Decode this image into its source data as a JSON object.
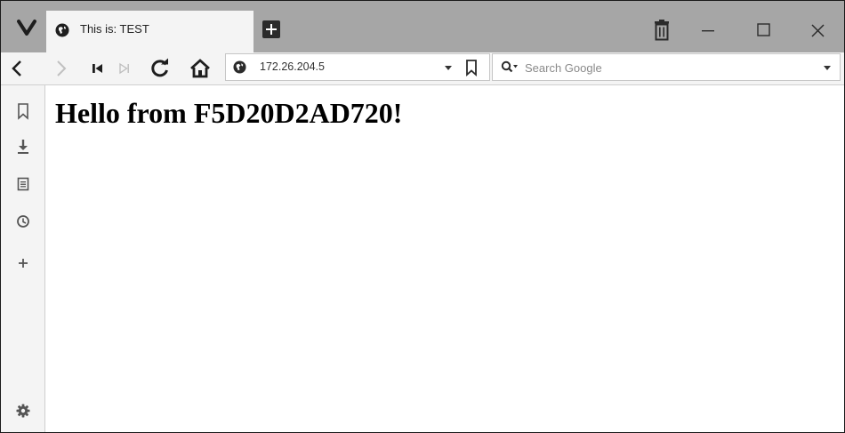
{
  "browser": {
    "logo_icon": "vivaldi-logo-icon",
    "accent_color": "#a6a6a6"
  },
  "tab": {
    "title": "This is: TEST",
    "icon": "globe-icon"
  },
  "titlebar": {
    "new_tab_icon": "plus-square-icon",
    "trash_icon": "trash-icon",
    "window_controls": [
      "minimize-icon",
      "maximize-icon",
      "close-icon"
    ]
  },
  "navigation": {
    "icons": [
      "back-icon",
      "forward-icon",
      "rewind-icon",
      "fast-forward-icon",
      "reload-icon",
      "home-icon"
    ]
  },
  "address": {
    "url": "172.26.204.5",
    "site_icon": "globe-icon"
  },
  "search": {
    "placeholder": "Search Google",
    "value": ""
  },
  "sidebar": {
    "items": [
      "bookmarks-icon",
      "downloads-icon",
      "notes-icon",
      "history-icon",
      "add-panel-icon"
    ],
    "settings_icon": "gear-icon"
  },
  "page": {
    "heading": "Hello from F5D20D2AD720!"
  }
}
